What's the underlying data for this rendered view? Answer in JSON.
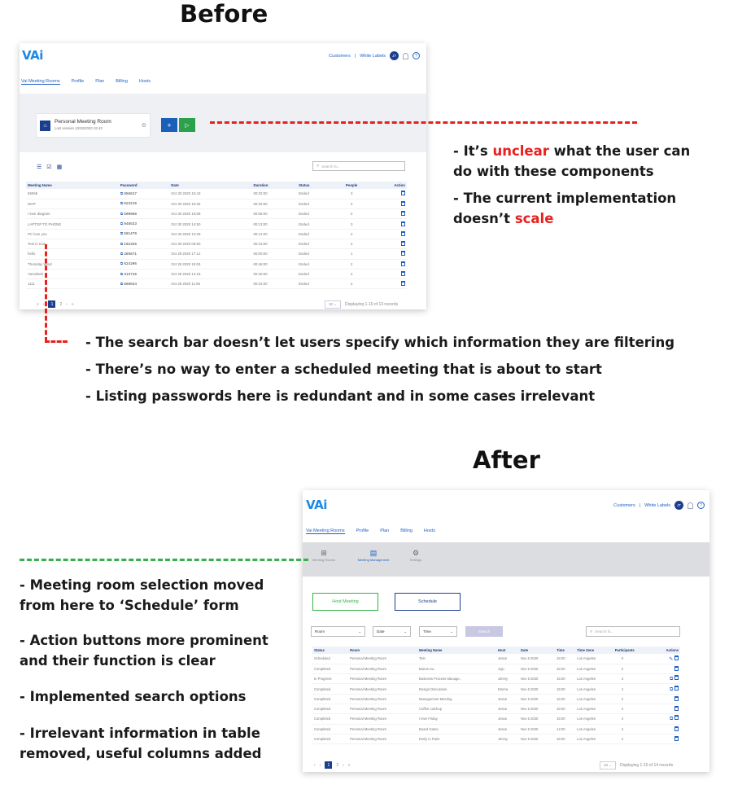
{
  "headings": {
    "before": "Before",
    "after": "After"
  },
  "app": {
    "logo": "VAi",
    "customers": "Customers",
    "separator": "|",
    "white_labels": "White Labels",
    "avatar": "JT",
    "help": "?",
    "nav": [
      "Vai Meeting Rooms",
      "Profile",
      "Plan",
      "Billing",
      "Hosts"
    ]
  },
  "before": {
    "room_card": {
      "title": "Personal Meeting Room",
      "subtitle": "Last session 10/30/2020 15:43"
    },
    "add_btn": "+",
    "play_btn": "▷",
    "search_placeholder": "Search fo...",
    "columns": [
      "Meeting Name",
      "Password",
      "Date",
      "Duration",
      "Status",
      "People",
      "Action"
    ],
    "rows": [
      [
        "55555",
        "856617",
        "Oct 30 2020 15:43",
        "00:32:00",
        "Ended",
        "3"
      ],
      [
        "WAP",
        "823216",
        "Oct 30 2020 15:26",
        "00:32:00",
        "Ended",
        "2"
      ],
      [
        "I love diagram",
        "590968",
        "Oct 30 2020 15:08",
        "00:56:00",
        "Ended",
        "2"
      ],
      [
        "LAPTOP TO PHONE",
        "948533",
        "Oct 30 2020 14:50",
        "00:13:00",
        "Ended",
        "3"
      ],
      [
        "PC love you",
        "581479",
        "Oct 30 2020 13:29",
        "00:12:00",
        "Ended",
        "2"
      ],
      [
        "Test in Ivan",
        "192326",
        "Oct 30 2020 09:50",
        "00:16:00",
        "Ended",
        "2"
      ],
      [
        "hello",
        "285671",
        "Oct 29 2020 17:12",
        "00:00:00",
        "Ended",
        "1"
      ],
      [
        "Thursday Wind",
        "624206",
        "Oct 29 2020 15:06",
        "00:46:00",
        "Ended",
        "2"
      ],
      [
        "Yaroslash",
        "313716",
        "Oct 29 2020 14:18",
        "00:40:00",
        "Ended",
        "2"
      ],
      [
        "1111",
        "850634",
        "Oct 29 2020 11:56",
        "00:24:00",
        "Ended",
        "2"
      ]
    ],
    "pager": {
      "prev2": "«",
      "prev": "‹",
      "page1": "1",
      "page2": "2",
      "next": "›",
      "next2": "»",
      "per_page": "10",
      "display": "Displaying 1-10 of 13 records"
    }
  },
  "after": {
    "subnav": [
      {
        "label": "Meeting Rooms",
        "icon": "meeting-rooms-icon"
      },
      {
        "label": "Meeting Management",
        "icon": "clipboard-icon"
      },
      {
        "label": "Settings",
        "icon": "settings-icon"
      }
    ],
    "host_meeting": "Host Meeting",
    "schedule": "Schedule",
    "filters": [
      "Room",
      "Date",
      "Time"
    ],
    "search_btn": "Search",
    "search_placeholder": "Search fo...",
    "columns": [
      "Status",
      "Room",
      "Meeting Name",
      "Host",
      "Date",
      "Time",
      "Time Zone",
      "Participants",
      "Actions"
    ],
    "rows": [
      [
        "Scheduled",
        "Personal Meeting Room",
        "Test",
        "Jesus",
        "Nov 6 2020",
        "15:00",
        "Los Angeles",
        "0"
      ],
      [
        "Completed",
        "Personal Meeting Room",
        "Bairos ew",
        "Jojo",
        "Nov 6 2020",
        "15:00",
        "Los Angeles",
        "2"
      ],
      [
        "In Progress",
        "Personal Meeting Room",
        "Business Process Manage..",
        "Jimmy",
        "Nov 6 2020",
        "15:00",
        "Los Angeles",
        "3"
      ],
      [
        "Completed",
        "Personal Meeting Room",
        "Design Discussion",
        "Emma",
        "Nov 6 2020",
        "15:00",
        "Los Angeles",
        "4"
      ],
      [
        "Completed",
        "Personal Meeting Room",
        "Management Meeting",
        "Jesus",
        "Nov 6 2020",
        "15:00",
        "Los Angeles",
        "2"
      ],
      [
        "Completed",
        "Personal Meeting Room",
        "Coffee catchup",
        "Jesus",
        "Nov 6 2020",
        "15:00",
        "Los Angeles",
        "4"
      ],
      [
        "Completed",
        "Personal Meeting Room",
        "I love Friday",
        "Jesus",
        "Nov 6 2020",
        "15:00",
        "Los Angeles",
        "4"
      ],
      [
        "Completed",
        "Personal Meeting Room",
        "Board Game",
        "Jesus",
        "Nov 6 2020",
        "14:00",
        "Los Angeles",
        "4"
      ],
      [
        "Completed",
        "Personal Meeting Room",
        "Emily in Paris",
        "Jimmy",
        "Nov 6 2020",
        "16:00",
        "Los Angeles",
        "4"
      ]
    ],
    "pager": {
      "first": "‹",
      "prev": "‹",
      "page1": "1",
      "page2": "2",
      "next": "›",
      "last": "»",
      "per_page": "10",
      "display": "Displaying 1-10 of 14 records"
    }
  },
  "notes_before_right": [
    {
      "pre": "- It’s ",
      "hl": "unclear",
      "post": " what the user can do with these components"
    },
    {
      "pre": "- The current implementation doesn’t ",
      "hl": "scale",
      "post": ""
    }
  ],
  "notes_before_bottom": [
    "- The search bar doesn’t let users specify which information they are filtering",
    "- There’s no way to enter a scheduled meeting that is about to start",
    "- Listing passwords here is redundant and in some cases irrelevant"
  ],
  "notes_after": [
    "- Meeting room selection moved from here to ‘Schedule’ form",
    "- Action buttons more prominent and their function is clear",
    "- Implemented search options",
    "- Irrelevant information in table removed, useful columns added"
  ],
  "colors": {
    "red": "#e8201e",
    "green": "#36b04a",
    "blue": "#1d5fc4",
    "navy": "#1b3f8f"
  }
}
